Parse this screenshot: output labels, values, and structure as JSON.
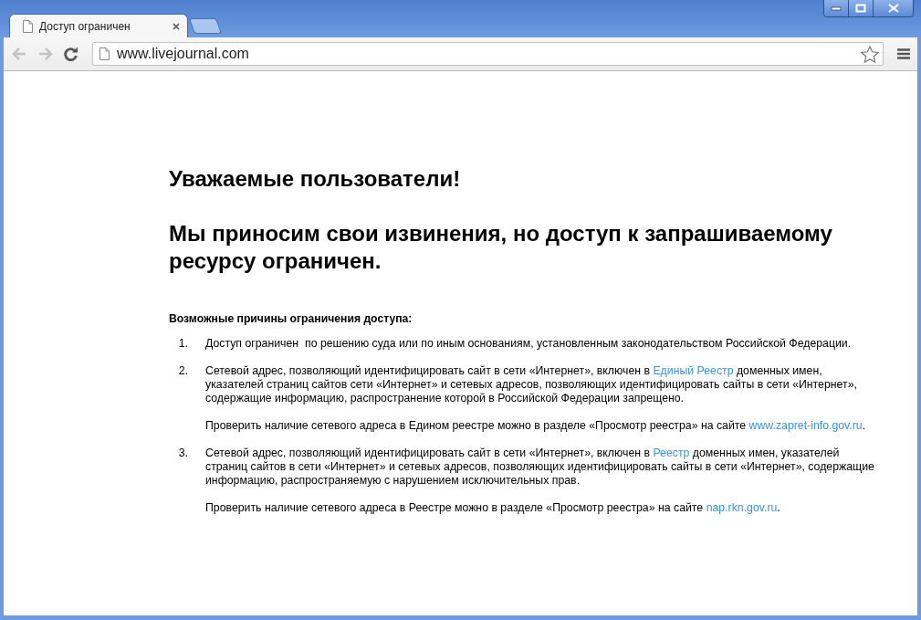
{
  "tabs": [
    {
      "title": "Доступ ограничен",
      "selected": true
    }
  ],
  "nav": [
    {
      "kind": "back",
      "disabled": true
    },
    {
      "kind": "forward",
      "disabled": true
    },
    {
      "kind": "reload",
      "disabled": false
    }
  ],
  "address": "www.livejournal.com",
  "page": {
    "headings": [
      "Уважаемые пользователи!",
      "Мы приносим свои извинения, но доступ к запрашиваемому ресурсу ограничен."
    ],
    "reasons_title": "Возможные причины ограничения доступа:",
    "reasons": [
      {
        "number": "1.",
        "paragraphs": [
          {
            "text": "Доступ ограничен  по решению суда или по иным основаниям, установленным законодательством Российской Федерации."
          }
        ]
      },
      {
        "number": "2.",
        "paragraphs": [
          {
            "text": "Сетевой адрес, позволяющий идентифицировать сайт в сети «Интернет», включен в ",
            "link": "Единый Реестр",
            "text_after": " доменных имен, указателей страниц сайтов сети «Интернет» и сетевых адресов, позволяющих идентифицировать сайты в сети «Интернет», содержащие информацию, распространение которой в Российской Федерации запрещено."
          },
          {
            "text": "Проверить наличие сетевого адреса в Едином реестре можно в разделе «Просмотр реестра» на сайте ",
            "link": "www.zapret-info.gov.ru",
            "text_after": "."
          }
        ]
      },
      {
        "number": "3.",
        "paragraphs": [
          {
            "text": "Сетевой адрес, позволяющий идентифицировать сайт в сети «Интернет», включен в ",
            "link": "Реестр",
            "text_after": " доменных имен, указателей страниц сайтов в сети «Интернет» и сетевых адресов, позволяющих идентифицировать сайты в сети «Интернет», содержащие информацию, распространяемую с нарушением исключительных прав."
          },
          {
            "text": "Проверить наличие сетевого адреса в Реестре можно в разделе «Просмотр реестра» на сайте ",
            "link": "nap.rkn.gov.ru",
            "text_after": "."
          }
        ]
      }
    ]
  }
}
